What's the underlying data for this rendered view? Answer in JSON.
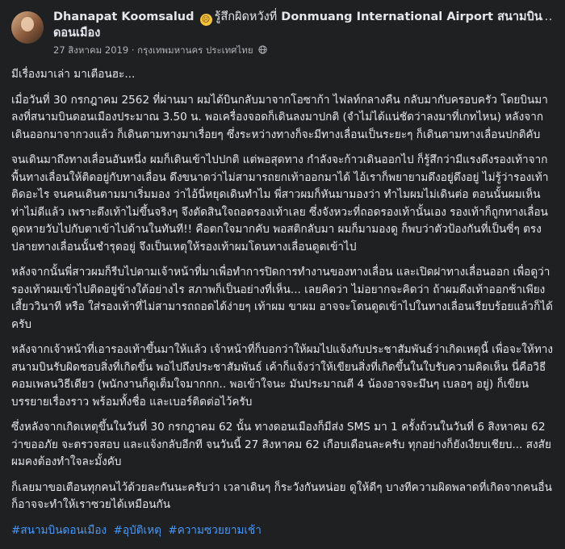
{
  "post": {
    "author": "Dhanapat Koomsalud",
    "emoji_char": "☹",
    "feeling": "รู้สึกผิดหวังที่",
    "place": "Donmuang International Airport สนามบินดอนเมือง",
    "date": "27 สิงหาคม 2019",
    "location": "กรุงเทพมหานคร ประเทศไทย",
    "more_icon": "⋯",
    "paragraphs": [
      "มีเรื่องมาเล่า มาเตือนฮะ...",
      "เมื่อวันที่ 30 กรกฎาคม 2562 ที่ผ่านมา ผมได้บินกลับมาจากโอซาก้า ไฟลท์กลางคืน กลับมากับครอบครัว โดยบินมาลงที่สนามบินดอนเมืองประมาณ 3.50 น. พอเครื่องจอดก็เดินลงมาปกติ (จำไม่ได้แน่ชัดว่าลงมาที่เกทไหน) หลังจากเดินออกมาจากวงแล้ว ก็เดินตามทางมาเรื่อยๆ ซึ่งระหว่างทางก็จะมีทางเลื่อนเป็นระยะๆ ก็เดินตามทางเลื่อนปกติคับ",
      "จนเดินมาถึงทางเลื่อนอันหนึ่ง ผมก็เดินเข้าไปปกติ แต่พอสุดทาง กำลังจะก้าวเดินออกไป ก็รู้สึกว่ามีแรงดึงรองเท้าจากพื้นทางเลื่อนให้ติดอยู่กับทางเลื่อน ดึงขนาดว่าไม่สามารถยกเท้าออกมาได้ ไอ้เราก็พยายามดึงอยู่ดึงอยู่ ไม่รู้ว่ารองเท้าติดอะไร จนคนเดินตามมาเริ่มมอง ว่าไอ้นี่หยุดเดินทำไม พี่สาวผมก็หันมามองว่า ทำไมผมไม่เดินต่อ ตอนนั้นผมเห็นท่าไม่ดีแล้ว เพราะดึงเท้าไม่ขึ้นจริงๆ จึงตัดสินใจถอดรองเท้าเลย ซึ่งจังหวะที่ถอดรองเท้านั้นเอง รองเท้าก็ถูกทางเลื่อนดูดหายวับไปกับตาเข้าไปด้านในทันที!! คือตกใจมากคับ พอสติกลับมา ผมก็มามองดู ก็พบว่าตัวป้องกันที่เป็นซี่ๆ ตรงปลายทางเลื่อนนั้นชำรุดอยู่ จึงเป็นเหตุให้รองเท้าผมโดนทางเลื่อนดูดเข้าไป",
      "หลังจากนั้นพี่สาวผมก็รีบไปตามเจ้าหน้าที่มาเพื่อทำการปิดการทำงานของทางเลื่อน และเปิดฝาทางเลื่อนออก เพื่อดูว่ารองเท้าผมเข้าไปติดอยู่ข้างใต้อย่างไร สภาพก็เป็นอย่างที่เห็น... เลยคิดว่า ไม่อยากจะคิดว่า ถ้าผมดึงเท้าออกช้าเพียงเสี้ยววินาที หรือ ใส่รองเท้าที่ไม่สามารถถอดได้ง่ายๆ เท้าผม ขาผม อาจจะโดนดูดเข้าไปในทางเลื่อนเรียบร้อยแล้วก็ได้ครับ",
      "หลังจากเจ้าหน้าที่เอารองเท้าขึ้นมาให้แล้ว เจ้าหน้าที่ก็บอกว่าให้ผมไปแจ้งกับประชาสัมพันธ์ว่าเกิดเหตุนี้ เพื่อจะให้ทางสนามบินรับผิดชอบสิ่งที่เกิดขึ้น พอไปถึงประชาสัมพันธ์ เค้าก็แจ้งว่าให้เขียนสิ่งที่เกิดขึ้นในใบรับความคิดเห็น นี่คือวิธีคอมเพลนวิธีเดียว (พนักงานก็ดูเต็มใจมากกก.. พอเข้าใจนะ มันประมาณตี 4 น้องอาจจะมึนๆ เบลอๆ อยู่) ก็เขียนบรรยายเรื่องราว พร้อมทั้งชื่อ และเบอร์ติดต่อไว้ครับ",
      "ซึ่งหลังจากเกิดเหตุขึ้นในวันที่ 30 กรกฎาคม 62 นั้น ทางดอนเมืองก็มีส่ง SMS มา 1 ครั้งถ้วนในวันที่ 6 สิงหาคม 62 ว่าขออภัย จะตรวจสอบ และแจ้งกลับอีกที จนวันนี้ 27 สิงหาคม 62 เกือบเดือนละครับ ทุกอย่างก็ยังเงียบเชียบ... สงสัย ผมคงต้องทำใจละมั้งคับ",
      "ก็เลยมาขอเตือนทุกคนไว้ด้วยละกันนะครับว่า เวลาเดินๆ ก็ระวังกันหน่อย ดูให้ดีๆ บางทีความผิดพลาดที่เกิดจากคนอื่น ก็อาจจะทำให้เราซวยได้เหมือนกัน"
    ],
    "hashtags": [
      "#สนามบินดอนเมือง",
      "#อุบัติเหตุ",
      "#ความซวยยามเช้า"
    ]
  }
}
